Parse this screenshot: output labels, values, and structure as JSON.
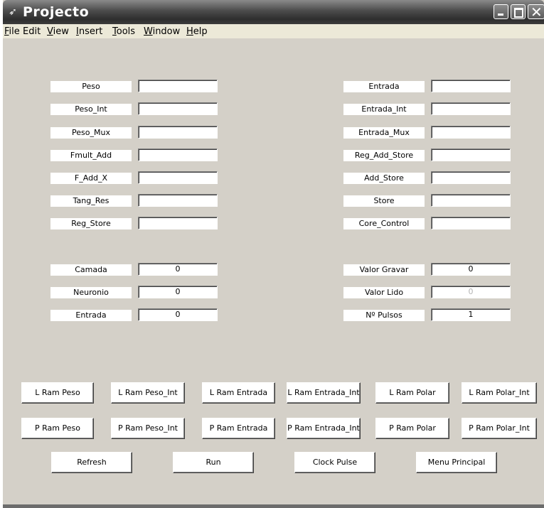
{
  "window": {
    "title": "Projecto"
  },
  "menu": {
    "file": "ile",
    "file_key": "F",
    "edit": "Edit",
    "view_key": "V",
    "view": "iew",
    "insert_key": "I",
    "insert": "nsert",
    "tools_key": "T",
    "tools": "ools",
    "window_key": "W",
    "window": "indow",
    "help_key": "H",
    "help": "elp"
  },
  "left_fields": [
    {
      "label": "Peso",
      "value": ""
    },
    {
      "label": "Peso_Int",
      "value": ""
    },
    {
      "label": "Peso_Mux",
      "value": ""
    },
    {
      "label": "Fmult_Add",
      "value": ""
    },
    {
      "label": "F_Add_X",
      "value": ""
    },
    {
      "label": "Tang_Res",
      "value": ""
    },
    {
      "label": "Reg_Store",
      "value": ""
    }
  ],
  "right_fields": [
    {
      "label": "Entrada",
      "value": ""
    },
    {
      "label": "Entrada_Int",
      "value": ""
    },
    {
      "label": "Entrada_Mux",
      "value": ""
    },
    {
      "label": "Reg_Add_Store",
      "value": ""
    },
    {
      "label": "Add_Store",
      "value": ""
    },
    {
      "label": "Store",
      "value": ""
    },
    {
      "label": "Core_Control",
      "value": ""
    }
  ],
  "left_params": [
    {
      "label": "Camada",
      "value": "0"
    },
    {
      "label": "Neuronio",
      "value": "0"
    },
    {
      "label": "Entrada",
      "value": "0"
    }
  ],
  "right_params": [
    {
      "label": "Valor Gravar",
      "value": "0"
    },
    {
      "label": "Valor Lido",
      "value": "0"
    },
    {
      "label": "Nº Pulsos",
      "value": "1"
    }
  ],
  "load_buttons": [
    "L Ram Peso",
    "L Ram Peso_Int",
    "L Ram Entrada",
    "L Ram Entrada_Int",
    "L Ram Polar",
    "L Ram Polar_Int"
  ],
  "print_buttons": [
    "P Ram Peso",
    "P Ram Peso_Int",
    "P Ram Entrada",
    "P Ram Entrada_Int",
    "P Ram Polar",
    "P Ram Polar_Int"
  ],
  "action_buttons": [
    "Refresh",
    "Run",
    "Clock Pulse",
    "Menu Principal"
  ],
  "colors": {
    "background": "#d4d0c8",
    "titlebar": "#3c3c3c",
    "disabled_text": "#b4b4b4"
  }
}
